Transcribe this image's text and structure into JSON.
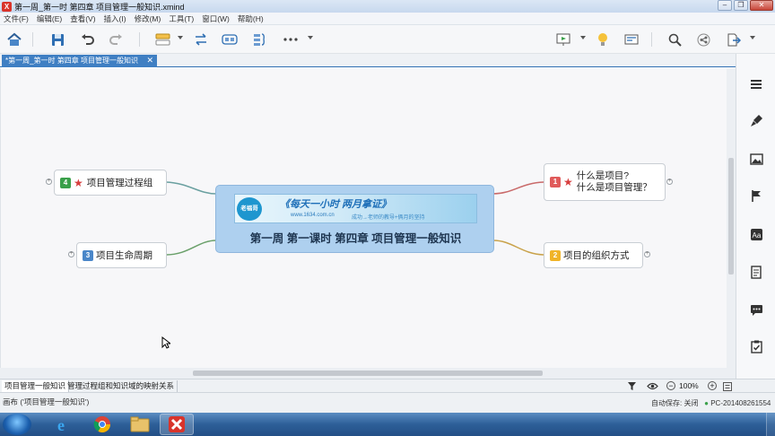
{
  "window": {
    "title": "第一周_第一时 第四章 项目管理一般知识.xmind",
    "logo": "X"
  },
  "menu": [
    "文件(F)",
    "编辑(E)",
    "查看(V)",
    "插入(I)",
    "修改(M)",
    "工具(T)",
    "窗口(W)",
    "帮助(H)"
  ],
  "document_tab": {
    "label": "*第一周_第一时 第四章 项目管理一般知识",
    "close": "✕"
  },
  "mindmap": {
    "central": {
      "title": "第一周 第一课时 第四章 项目管理一般知识",
      "banner_logo": "老福哥",
      "banner_slogan": "《每天一小时 两月拿证》",
      "banner_url": "www.1634.com.cn",
      "banner_motto": "成功→老师的教导+俩月的坚持"
    },
    "topics": [
      {
        "number": "1",
        "badge_color": "#e05a5a",
        "starred": true,
        "line1": "什么是项目?",
        "line2": "什么是项目管理？"
      },
      {
        "number": "2",
        "badge_color": "#f0b428",
        "starred": false,
        "text": "项目的组织方式"
      },
      {
        "number": "3",
        "badge_color": "#4a86c8",
        "starred": false,
        "text": "项目生命周期"
      },
      {
        "number": "4",
        "badge_color": "#3aa04a",
        "starred": true,
        "text": "项目管理过程组"
      }
    ],
    "colors": {
      "central_fill": "#aed0ef",
      "branch_red": "#c96a6a",
      "branch_amber": "#c9a24a",
      "branch_green": "#6aa06a",
      "branch_teal": "#6aa0a0"
    }
  },
  "sheets": [
    "项目管理一般知识",
    "管理过程组和知识域的映射关系"
  ],
  "zoom": "100%",
  "status": {
    "left": "画布 ('项目管理一般知识')",
    "autosave": "自动保存: 关闭",
    "computer": "PC-201408261554"
  }
}
